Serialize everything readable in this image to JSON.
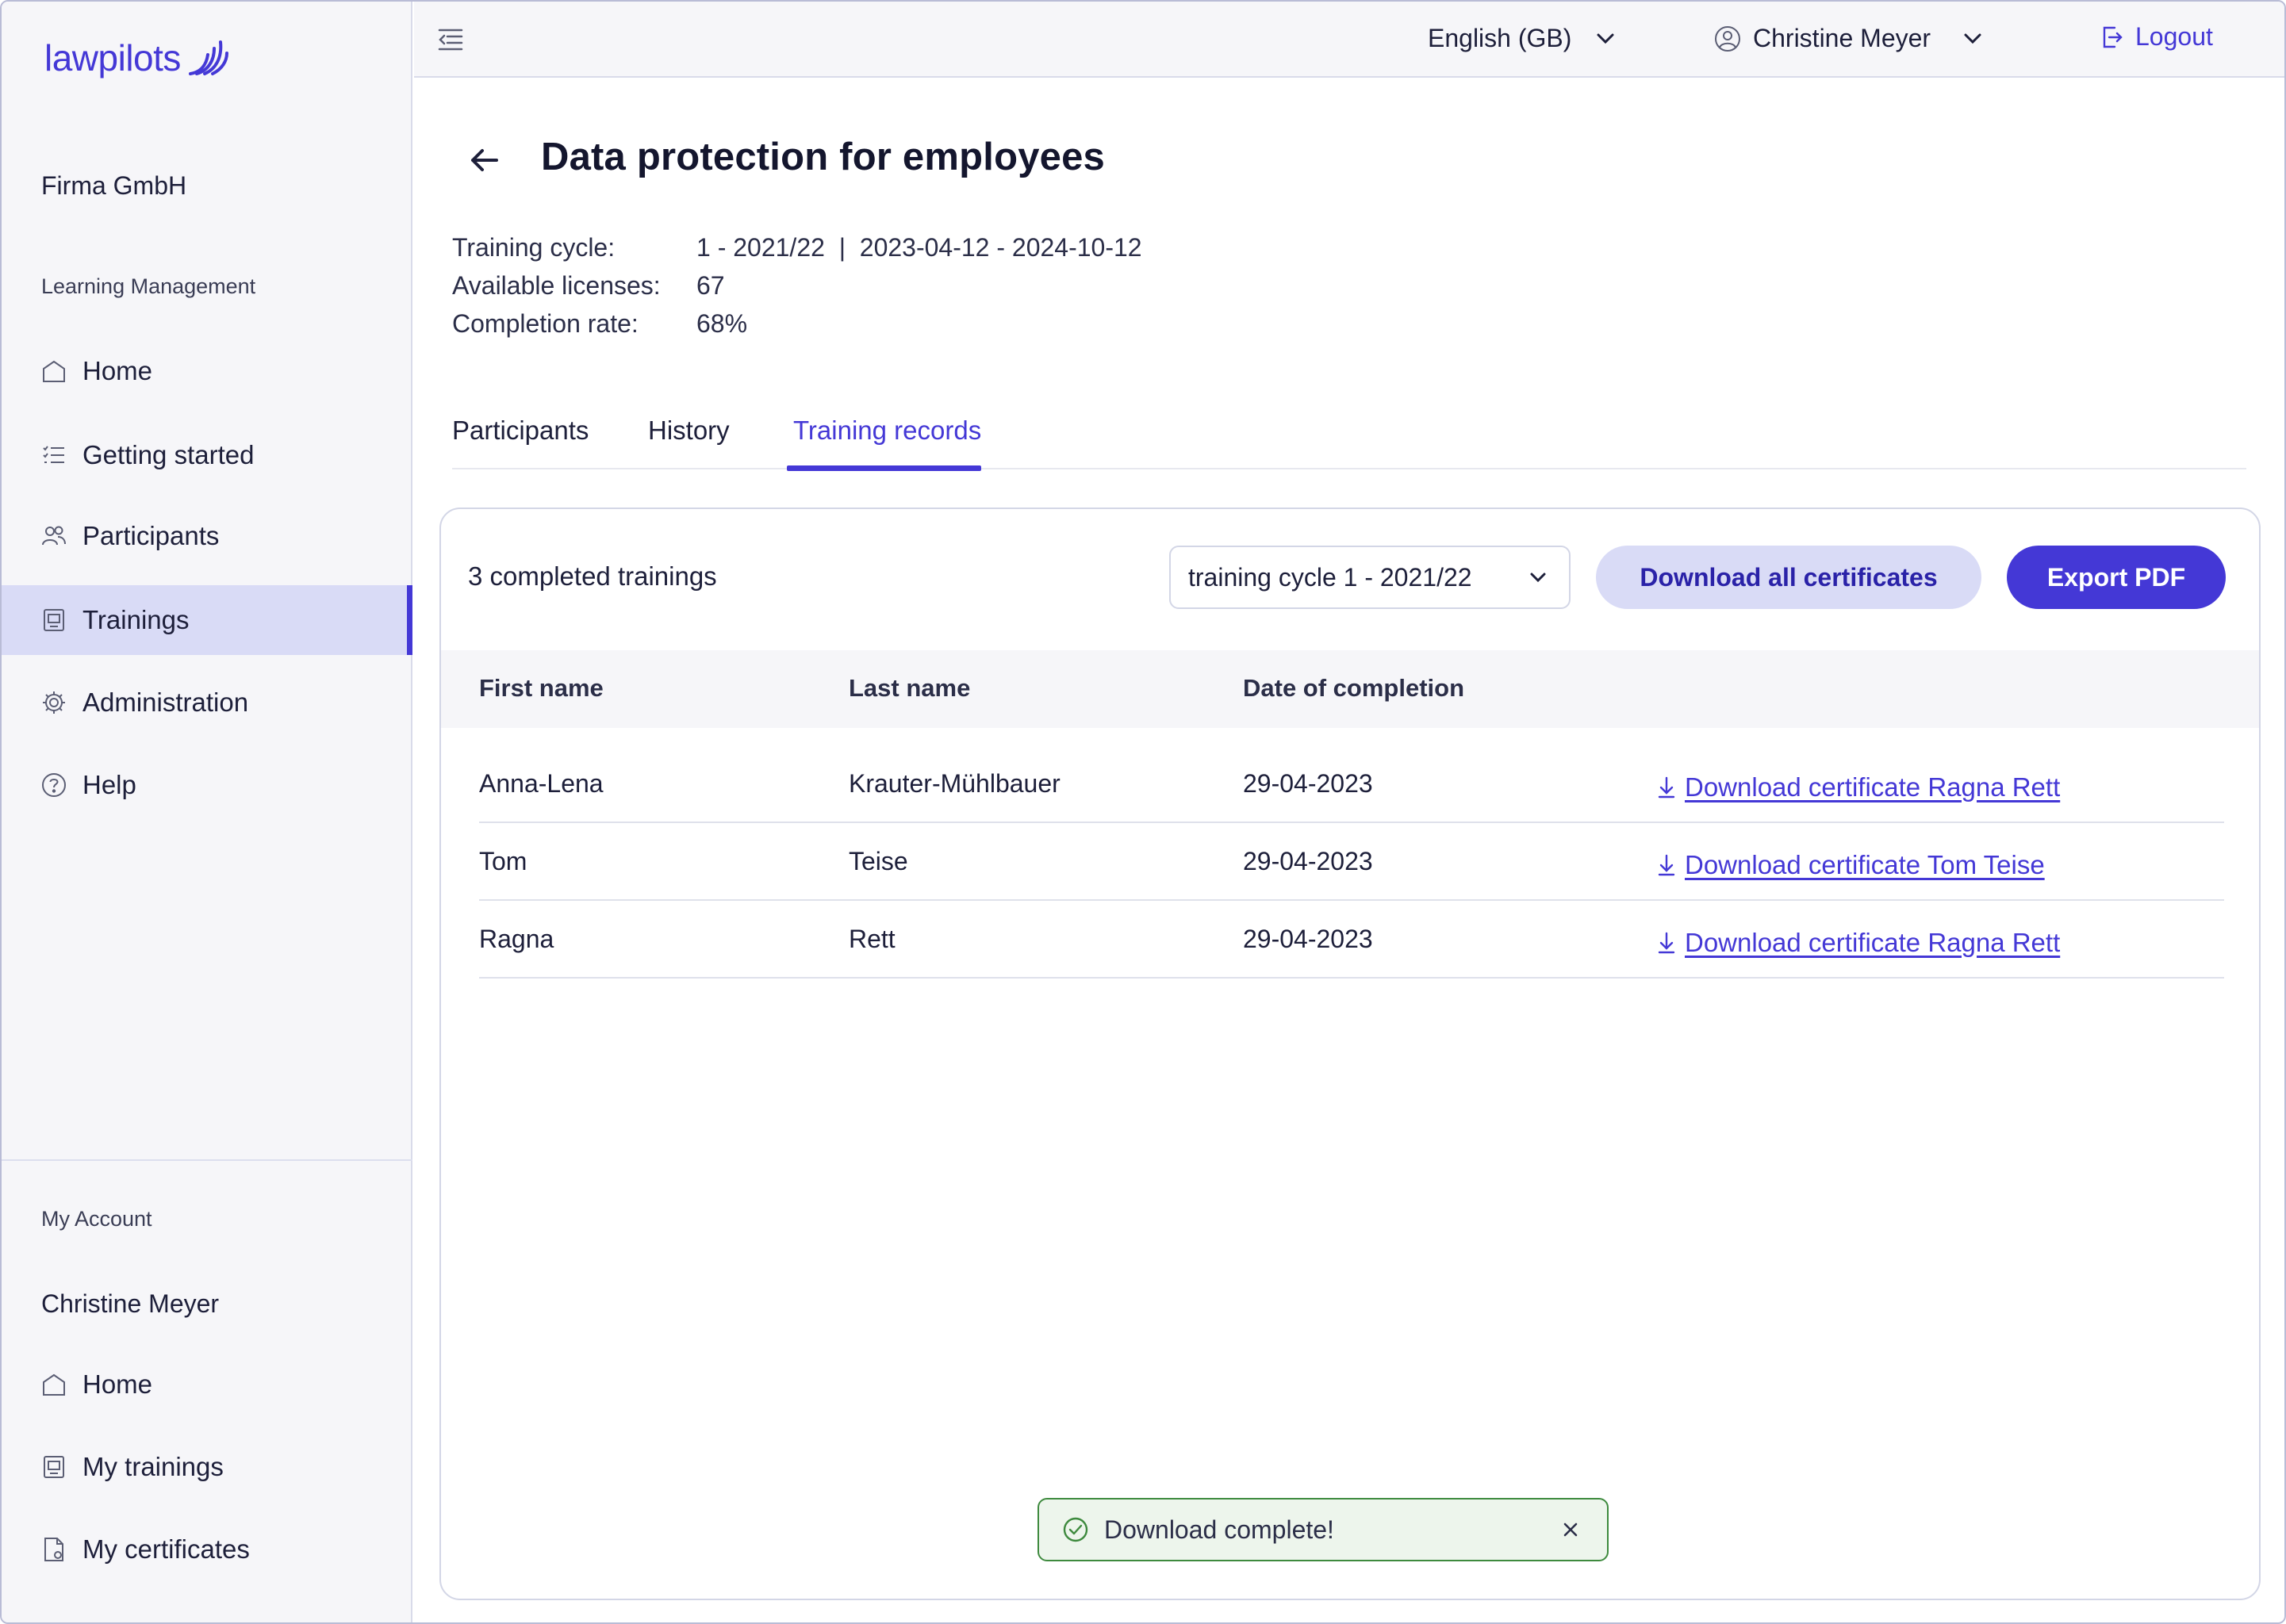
{
  "app": {
    "brand": "lawpilots",
    "company": "Firma GmbH"
  },
  "sidebar": {
    "section_learning": "Learning Management",
    "items": [
      {
        "label": "Home",
        "icon": "home-icon"
      },
      {
        "label": "Getting started",
        "icon": "checklist-icon"
      },
      {
        "label": "Participants",
        "icon": "users-icon"
      },
      {
        "label": "Trainings",
        "icon": "training-icon",
        "active": true
      },
      {
        "label": "Administration",
        "icon": "gear-icon"
      },
      {
        "label": "Help",
        "icon": "help-icon"
      }
    ],
    "section_account": "My Account",
    "account_name": "Christine Meyer",
    "account_items": [
      {
        "label": "Home",
        "icon": "home-icon"
      },
      {
        "label": "My trainings",
        "icon": "training-icon"
      },
      {
        "label": "My certificates",
        "icon": "certificate-icon"
      }
    ]
  },
  "topbar": {
    "language": "English (GB)",
    "user": "Christine Meyer",
    "logout": "Logout"
  },
  "page": {
    "title": "Data protection for employees",
    "info": [
      {
        "key": "Training cycle:",
        "value": "1 - 2021/22  |  2023-04-12 - 2024-10-12"
      },
      {
        "key": "Available licenses:",
        "value": "67"
      },
      {
        "key": "Completion rate:",
        "value": "68%"
      }
    ],
    "tabs": [
      "Participants",
      "History",
      "Training records"
    ],
    "active_tab": "Training records"
  },
  "records": {
    "count_label": "3 completed trainings",
    "cycle_select": "training cycle 1 - 2021/22",
    "download_all": "Download all certificates",
    "export_pdf": "Export PDF",
    "columns": [
      "First name",
      "Last name",
      "Date of completion"
    ],
    "rows": [
      {
        "first": "Anna-Lena",
        "last": "Krauter-Mühlbauer",
        "date": "29-04-2023",
        "link": "Download certificate Ragna Rett"
      },
      {
        "first": "Tom",
        "last": "Teise",
        "date": "29-04-2023",
        "link": "Download certificate Tom Teise"
      },
      {
        "first": "Ragna",
        "last": "Rett",
        "date": "29-04-2023",
        "link": "Download certificate Ragna Rett"
      }
    ]
  },
  "toast": {
    "message": "Download complete!"
  },
  "colors": {
    "accent": "#4438d6",
    "accent_light": "#d9dbf6",
    "success": "#3e8a3e",
    "sidebar_bg": "#f6f6f9"
  }
}
